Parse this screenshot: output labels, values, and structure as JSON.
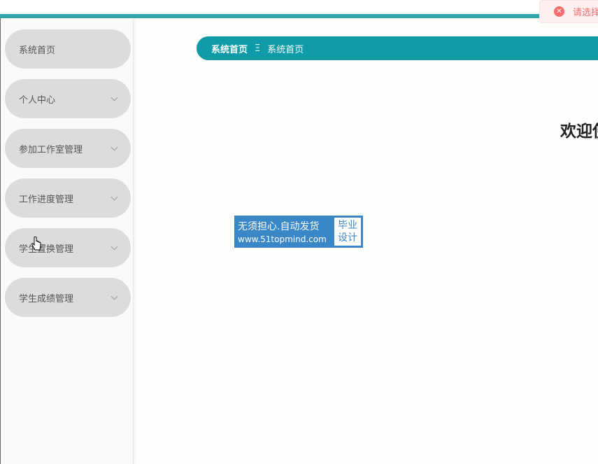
{
  "toast": {
    "message": "请选择",
    "icon": "close-circle-icon",
    "color": "#f56c6c"
  },
  "sidebar": {
    "items": [
      {
        "label": "系统首页",
        "has_chevron": false
      },
      {
        "label": "个人中心",
        "has_chevron": true
      },
      {
        "label": "参加工作室管理",
        "has_chevron": true
      },
      {
        "label": "工作进度管理",
        "has_chevron": true
      },
      {
        "label": "学生置换管理",
        "has_chevron": true
      },
      {
        "label": "学生成绩管理",
        "has_chevron": true
      }
    ]
  },
  "breadcrumb": {
    "home": "系统首页",
    "separator": "Ξ",
    "current": "系统首页"
  },
  "main": {
    "welcome": "欢迎使"
  },
  "ad": {
    "line1": "无须担心.自动发货",
    "line2": "www.51topmind.com",
    "tag1": "毕业",
    "tag2": "设计"
  },
  "colors": {
    "accent": "#2fa7ad",
    "breadcrumb_bg": "#0e9aa7",
    "menu_bg": "#dcdcdc"
  }
}
